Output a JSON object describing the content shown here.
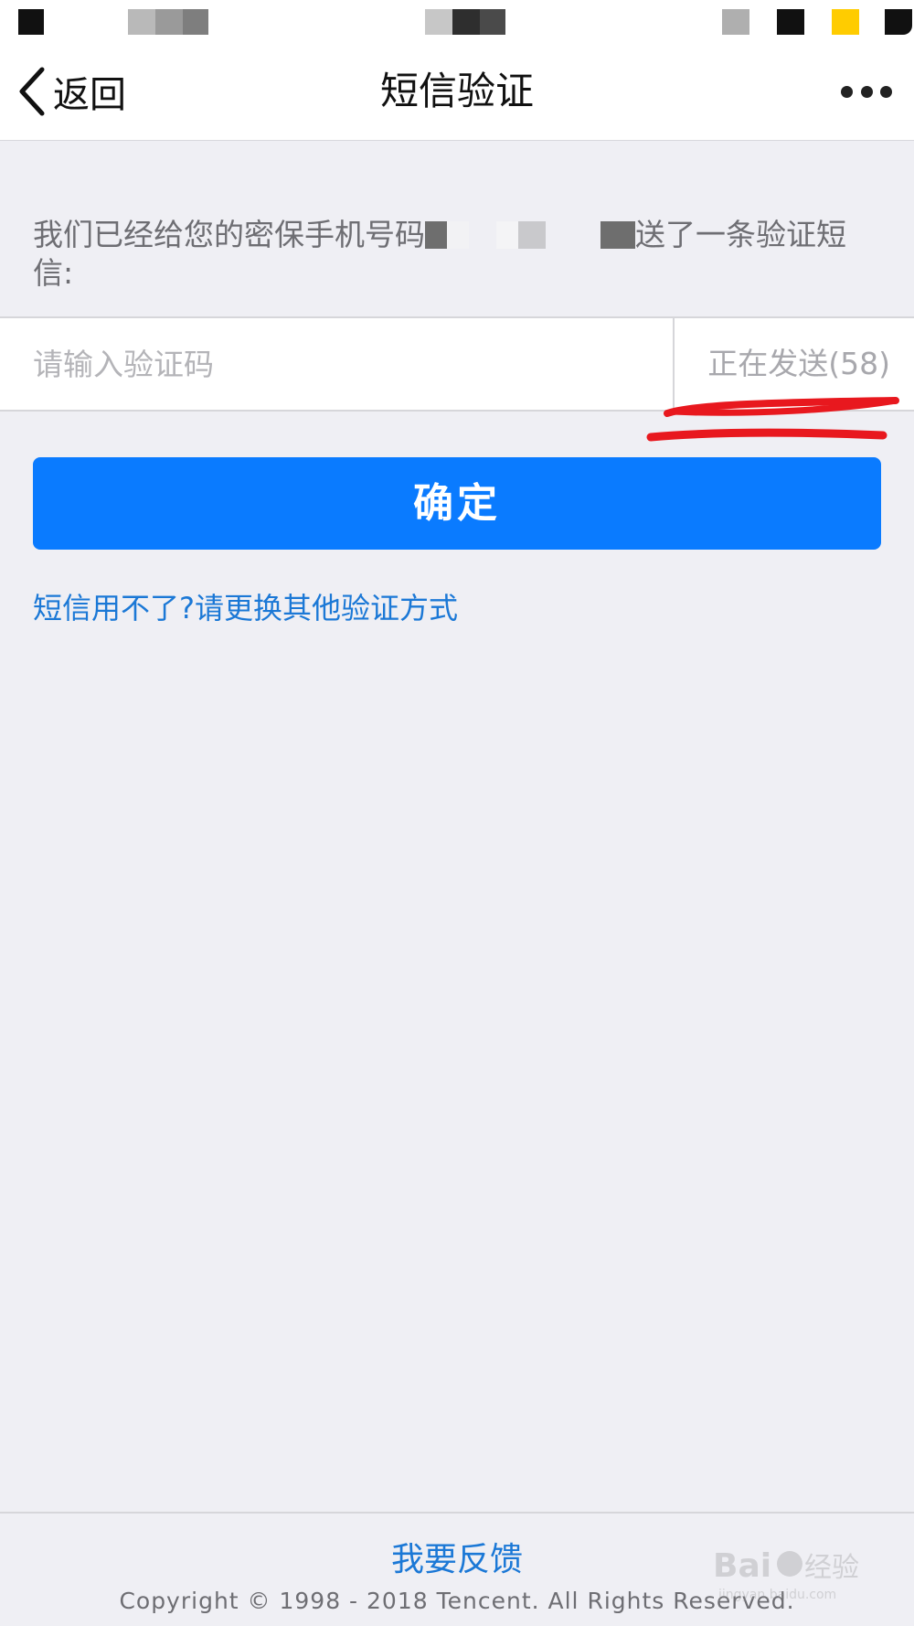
{
  "nav": {
    "back_label": "返回",
    "title": "短信验证",
    "back_icon": "chevron-left-icon",
    "more_icon": "more-dots-icon"
  },
  "notice": {
    "prefix": "我们已经给您的密保手机号码",
    "suffix": "送了一条验证短信:"
  },
  "form": {
    "code_placeholder": "请输入验证码",
    "send_status": "正在发送(58)",
    "confirm_label": "确定"
  },
  "links": {
    "alternate": "短信用不了?请更换其他验证方式",
    "feedback": "我要反馈"
  },
  "footer": {
    "copyright": "Copyright © 1998 - 2018 Tencent. All Rights Reserved."
  },
  "watermark": {
    "brand": "Bai du 经验",
    "domain": "jingyan.baidu.com"
  },
  "colors": {
    "accent": "#0A7BFF",
    "link": "#1B78D6",
    "annotation": "#E8181E",
    "background": "#EFEFF4"
  }
}
